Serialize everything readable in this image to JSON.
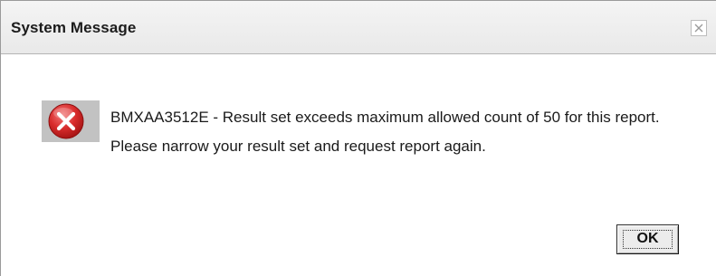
{
  "dialog": {
    "title": "System Message",
    "close_icon": "close-icon",
    "message_icon": "error-icon",
    "message": "BMXAA3512E - Result set exceeds maximum allowed count of 50 for this report. Please narrow your result set and request report again.",
    "ok_label": "OK"
  },
  "colors": {
    "title_bar": "#ededed",
    "error_red": "#d92c2c",
    "icon_backdrop": "#c2c2c2",
    "button_face": "#ececec"
  }
}
